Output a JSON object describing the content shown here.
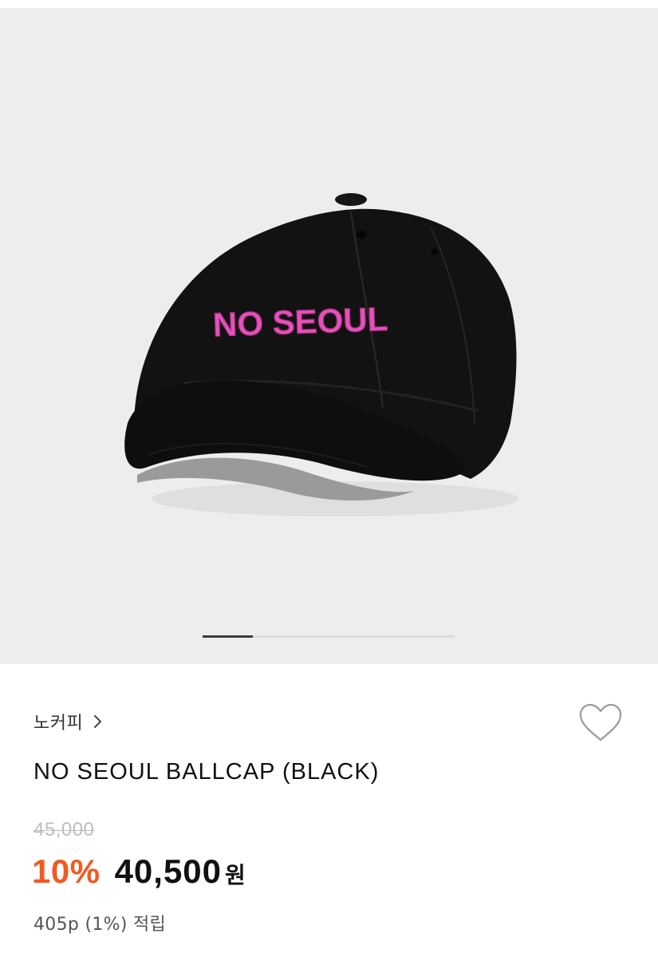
{
  "gallery": {
    "image_alt": "NO SEOUL BALLCAP (BLACK) product photo",
    "embroidery_text": "NO SEOUL",
    "current_slide": 1,
    "total_slides": 5,
    "progress_fraction": 0.2,
    "colors": {
      "background": "#eeeded",
      "cap": "#121212",
      "embroidery": "#e552b8",
      "progress_fill": "#3c3c3c",
      "progress_track": "#dcdcdc"
    }
  },
  "product": {
    "brand": "노커피",
    "brand_chevron_icon": "chevron-right-icon",
    "wish_icon": "heart-outline-icon",
    "title": "NO SEOUL BALLCAP (BLACK)",
    "original_price": "45,000",
    "discount_rate": "10%",
    "sale_price": "40,500",
    "currency": "원",
    "points": "405p (1%) 적립"
  },
  "colors": {
    "accent": "#f15a22",
    "text_primary": "#111111",
    "text_muted": "#bdbdbd"
  }
}
